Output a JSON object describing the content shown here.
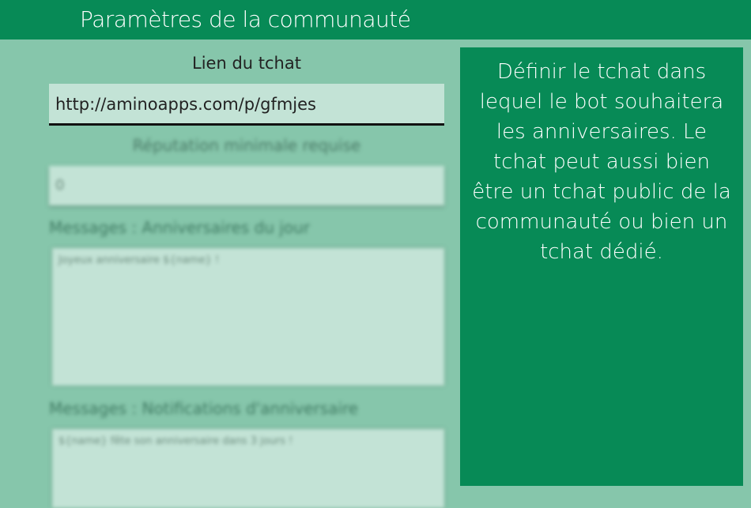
{
  "header": {
    "title": "Paramètres de la communauté"
  },
  "fields": {
    "chat_link": {
      "label": "Lien du tchat",
      "value": "http://aminoapps.com/p/gfmjes"
    },
    "min_reputation": {
      "label": "Réputation minimale requise",
      "value": "0"
    },
    "today_message": {
      "label": "Messages : Anniversaires du jour",
      "value": "Joyeux anniversaire ${name} !"
    },
    "notify_message": {
      "label": "Messages : Notifications d'anniversaire",
      "value": "${name} fête son anniversaire dans 3 jours !"
    }
  },
  "help": {
    "text": "Définir le tchat dans lequel le bot souhaitera les anniversaires. Le tchat peut aussi bien être un tchat public de la communauté ou bien un tchat dédié."
  }
}
